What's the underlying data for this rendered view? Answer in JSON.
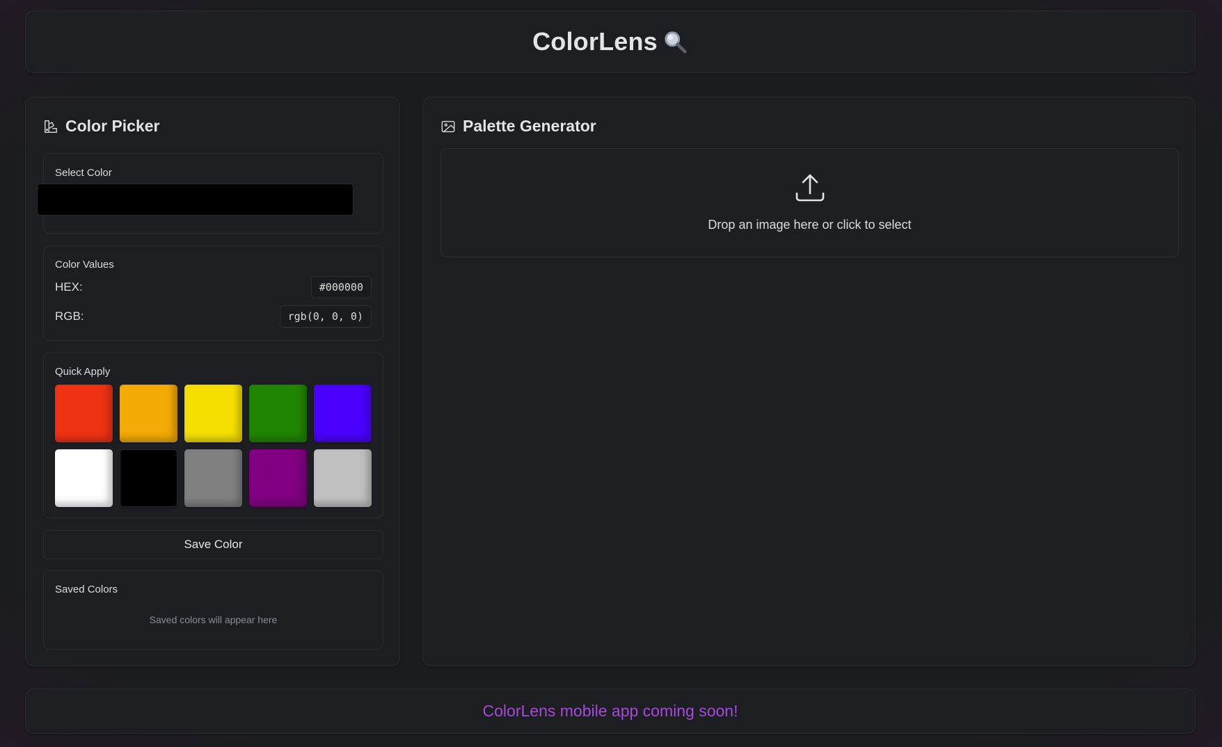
{
  "header": {
    "title": "ColorLens",
    "icon": "magnifying-glass-icon"
  },
  "color_picker": {
    "title": "Color Picker",
    "icon": "palette-icon",
    "select_label": "Select Color",
    "selected_color": "#000000",
    "values_label": "Color Values",
    "hex_label": "HEX:",
    "hex_value": "#000000",
    "rgb_label": "RGB:",
    "rgb_value": "rgb(0, 0, 0)",
    "quick_apply_label": "Quick Apply",
    "swatches": [
      "#f03214",
      "#f3ab05",
      "#f5df00",
      "#218504",
      "#4a00fd",
      "#ffffff",
      "#000000",
      "#808080",
      "#800080",
      "#c0c0c0"
    ],
    "save_button": "Save Color",
    "saved_label": "Saved Colors",
    "saved_empty": "Saved colors will appear here"
  },
  "palette_generator": {
    "title": "Palette Generator",
    "icon": "image-icon",
    "upload_icon": "upload-icon",
    "drop_text": "Drop an image here or click to select"
  },
  "footer": {
    "text": "ColorLens mobile app coming soon!",
    "color": "#a64ad9"
  }
}
